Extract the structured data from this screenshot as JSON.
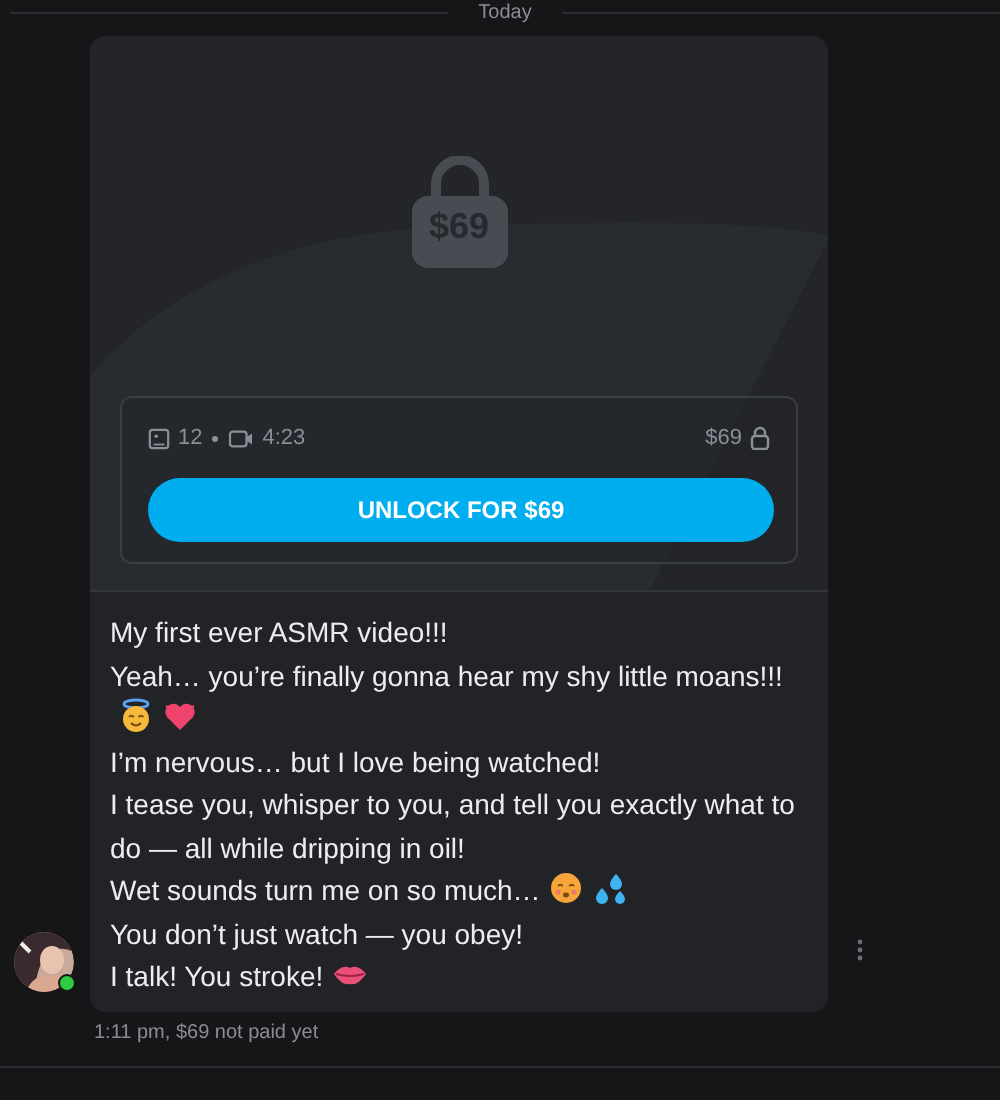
{
  "day_divider": "Today",
  "message": {
    "locked_media": {
      "price_badge": "$69",
      "photos": "12",
      "video_length": "4:23",
      "price": "$69",
      "unlock_button": "UNLOCK FOR $69"
    },
    "lines": [
      {
        "text": "My first ever ASMR video!!!"
      },
      {
        "text": "Yeah… you’re finally gonna hear my shy little moans!!!"
      },
      {
        "icons": [
          {
            "kind": "halo-face"
          },
          {
            "kind": "heart"
          }
        ]
      },
      {
        "text": "I’m nervous… but I love being watched!"
      },
      {
        "text": "I tease you, whisper to you, and tell you exactly what to do — all while dripping in oil!"
      },
      {
        "text": "Wet sounds turn me on so much…",
        "icons": [
          {
            "kind": "blush-face"
          },
          {
            "kind": "droplets"
          }
        ]
      },
      {
        "text": "You don’t just watch — you obey!"
      },
      {
        "text": "I talk! You stroke!",
        "icons": [
          {
            "kind": "lips"
          }
        ]
      }
    ],
    "sender_online": true,
    "footer": "1:11 pm,  $69 not paid yet"
  }
}
